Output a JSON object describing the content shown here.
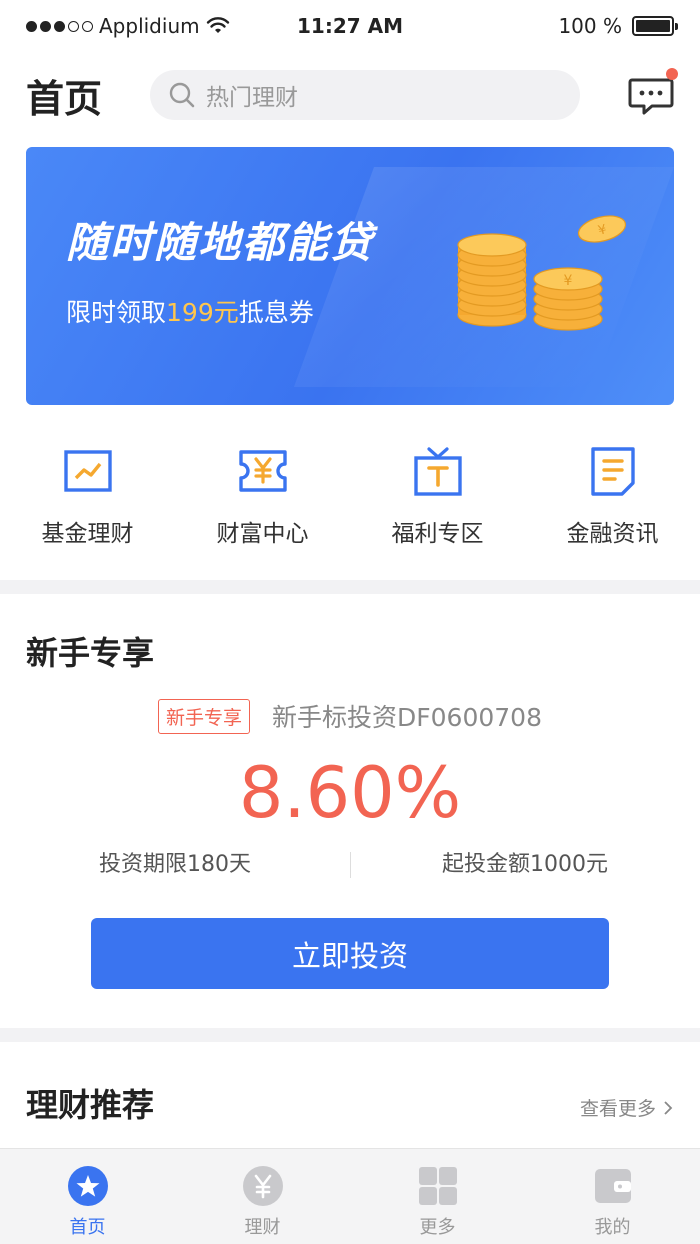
{
  "status_bar": {
    "carrier": "Applidium",
    "time": "11:27 AM",
    "battery_text": "100 %",
    "battery_level": 1.0
  },
  "header": {
    "title": "首页",
    "search_placeholder": "热门理财",
    "message_icon": "message-icon",
    "has_unread": true,
    "unread_color": "#f26452"
  },
  "banner": {
    "title": "随时随地都能贷",
    "sub_prefix": "限时领取",
    "sub_highlight": "199元",
    "sub_suffix": "抵息券",
    "highlight_color": "#ffc64d",
    "image": "gold-coins-illustration"
  },
  "quick_menu": [
    {
      "label": "基金理财",
      "icon": "fund-chart-icon"
    },
    {
      "label": "财富中心",
      "icon": "yuan-ticket-icon"
    },
    {
      "label": "福利专区",
      "icon": "gift-tv-icon"
    },
    {
      "label": "金融资讯",
      "icon": "news-document-icon"
    }
  ],
  "newbie": {
    "section_title": "新手专享",
    "tag": "新手专享",
    "product_name": "新手标投资DF0600708",
    "rate": "8.60%",
    "term": "投资期限180天",
    "min_amount": "起投金额1000元",
    "cta": "立即投资",
    "accent_color": "#f26452",
    "button_color": "#3a74f0"
  },
  "recommend": {
    "section_title": "理财推荐",
    "more": "查看更多"
  },
  "tabbar": {
    "items": [
      {
        "label": "首页",
        "icon": "home-star-icon",
        "active": true
      },
      {
        "label": "理财",
        "icon": "yuan-coin-icon",
        "active": false
      },
      {
        "label": "更多",
        "icon": "grid-icon",
        "active": false
      },
      {
        "label": "我的",
        "icon": "wallet-icon",
        "active": false
      }
    ],
    "active_color": "#3a74f0"
  }
}
